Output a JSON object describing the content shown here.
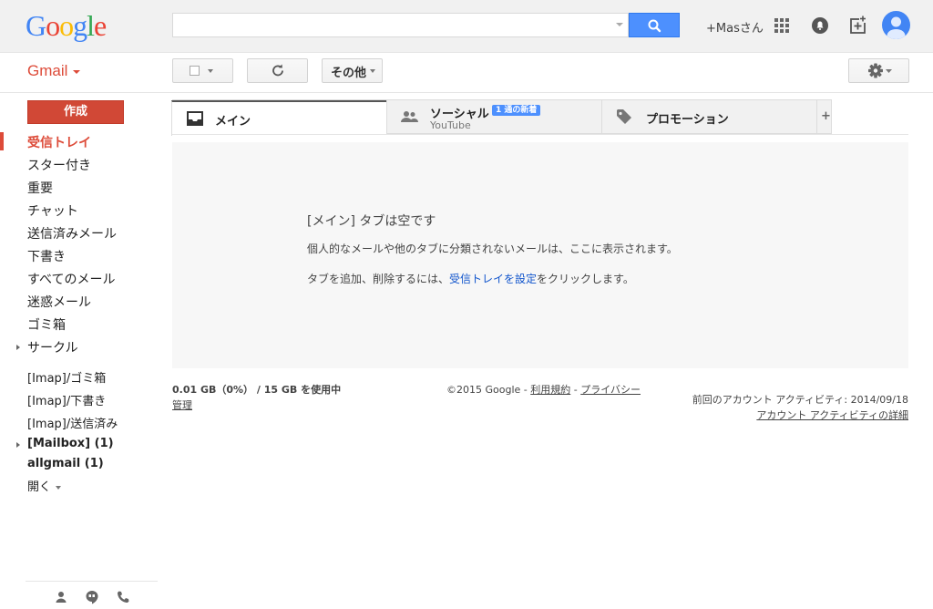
{
  "header": {
    "logo_letters": [
      {
        "ch": "G",
        "color": "#4285f4"
      },
      {
        "ch": "o",
        "color": "#ea4335"
      },
      {
        "ch": "o",
        "color": "#fbbc05"
      },
      {
        "ch": "g",
        "color": "#4285f4"
      },
      {
        "ch": "l",
        "color": "#34a853"
      },
      {
        "ch": "e",
        "color": "#ea4335"
      }
    ],
    "search": {
      "value": "",
      "placeholder": ""
    },
    "user_name": "+Masさん",
    "icons": [
      "apps-grid-icon",
      "notifications-bell-icon",
      "share-plus-icon",
      "avatar"
    ]
  },
  "toolbar": {
    "app_label": "Gmail",
    "more_label": "その他"
  },
  "sidebar": {
    "compose_label": "作成",
    "items": [
      {
        "label": "受信トレイ",
        "active": true
      },
      {
        "label": "スター付き"
      },
      {
        "label": "重要"
      },
      {
        "label": "チャット"
      },
      {
        "label": "送信済みメール"
      },
      {
        "label": "下書き"
      },
      {
        "label": "すべてのメール"
      },
      {
        "label": "迷惑メール"
      },
      {
        "label": "ゴミ箱"
      },
      {
        "label": "サークル",
        "expandable": true
      }
    ],
    "labels": [
      {
        "label": "[Imap]/ゴミ箱"
      },
      {
        "label": "[Imap]/下書き"
      },
      {
        "label": "[Imap]/送信済み"
      },
      {
        "label": "[Mailbox] (1)",
        "bold": true,
        "expandable": true
      },
      {
        "label": "allgmail (1)",
        "bold": true
      }
    ],
    "more_label": "開く"
  },
  "tabs": [
    {
      "label": "メイン",
      "icon": "inbox-icon",
      "active": true
    },
    {
      "label": "ソーシャル",
      "sublabel": "YouTube",
      "badge": "1 通の新着",
      "icon": "people-icon"
    },
    {
      "label": "プロモーション",
      "icon": "tag-icon"
    }
  ],
  "add_tab_label": "+",
  "empty": {
    "title": "[メイン] タブは空です",
    "description": "個人的なメールや他のタブに分類されないメールは、ここに表示されます。",
    "hint_prefix": "タブを追加、削除するには、",
    "hint_link": "受信トレイを設定",
    "hint_suffix": "をクリックします。"
  },
  "footer": {
    "storage": "0.01 GB（0%） / 15 GB を使用中",
    "manage": "管理",
    "copyright": "©2015 Google - ",
    "terms": "利用規約",
    "sep": " - ",
    "privacy": "プライバシー",
    "last_activity": "前回のアカウント アクティビティ: 2014/09/18",
    "details": "アカウント アクティビティの詳細"
  },
  "colors": {
    "accent": "#dd4b39",
    "link": "#1155cc",
    "search_button": "#4d90fe"
  }
}
